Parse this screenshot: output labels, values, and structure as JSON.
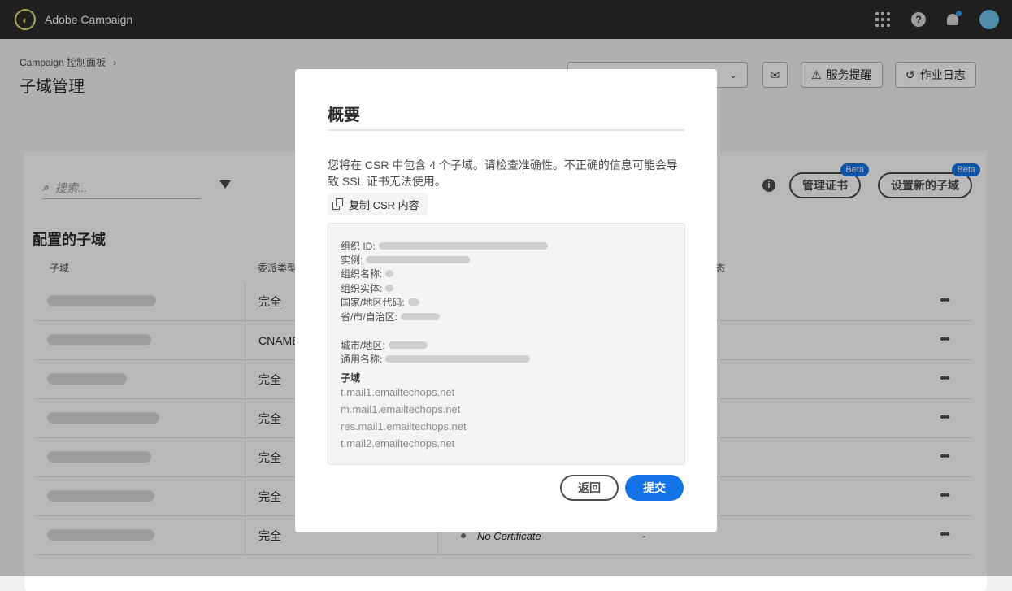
{
  "app": {
    "title": "Adobe Campaign",
    "logo_icon": "adobe-campaign-logo"
  },
  "header": {
    "breadcrumb": "Campaign 控制面板",
    "breadcrumb_sep": "›",
    "page_title": "子域管理",
    "select_chevron": "⌄",
    "service_alerts_label": "服务提醒",
    "job_log_label": "作业日志"
  },
  "toolbar": {
    "search_placeholder": "搜索...",
    "info_glyph": "i",
    "manage_cert_label": "管理证书",
    "setup_subdomain_label": "设置新的子域",
    "beta_badge": "Beta"
  },
  "table": {
    "section_title": "配置的子域",
    "columns": [
      "子域",
      "委派类型",
      "态"
    ],
    "rows": [
      {
        "type": "完全"
      },
      {
        "type": "CNAME"
      },
      {
        "type": "完全"
      },
      {
        "type": "完全"
      },
      {
        "type": "完全"
      },
      {
        "type": "完全"
      },
      {
        "type": "完全",
        "cert": "No Certificate",
        "extra": "-"
      }
    ],
    "row_menu": "•••"
  },
  "modal": {
    "title": "概要",
    "description": "您将在 CSR 中包含 4 个子域。请检查准确性。不正确的信息可能会导致 SSL 证书无法使用。",
    "copy_label": "复制 CSR 内容",
    "fields": {
      "org_id": "组织 ID:",
      "instance": "实例:",
      "org_name": "组织名称:",
      "org_unit": "组织实体:",
      "country": "国家/地区代码:",
      "state": "省/市/自治区:",
      "city": "城市/地区:",
      "common_name": "通用名称:"
    },
    "subdomains_title": "子域",
    "subdomains": [
      "t.mail1.emailtechops.net",
      "m.mail1.emailtechops.net",
      "res.mail1.emailtechops.net",
      "t.mail2.emailtechops.net"
    ],
    "back_label": "返回",
    "submit_label": "提交"
  }
}
